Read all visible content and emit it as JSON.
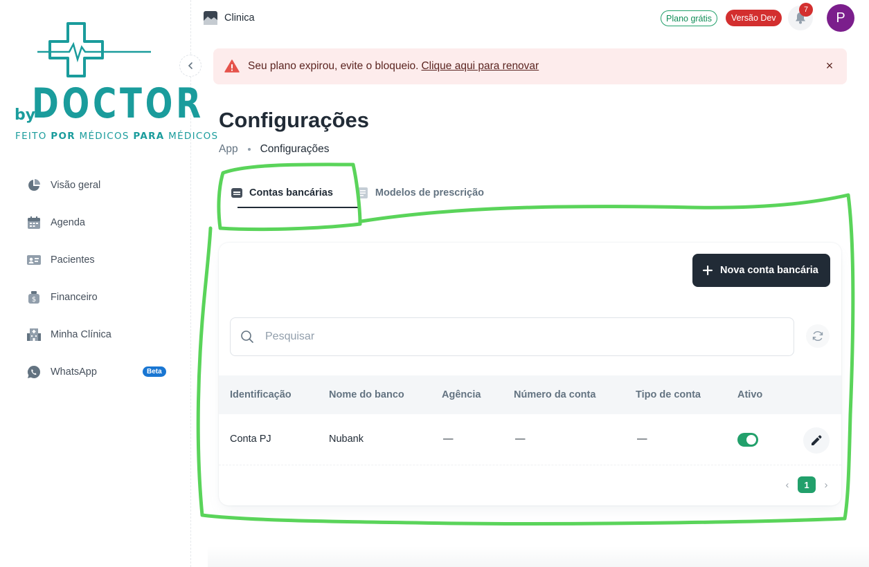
{
  "brand": {
    "by": "by",
    "name": "DOCTOR",
    "tagline_parts": [
      "FEITO ",
      "POR",
      " MÉDICOS ",
      "PARA",
      " MÉDICOS"
    ],
    "color": "#1a9c9c"
  },
  "sidebar": {
    "collapse_icon": "chevron-left-icon",
    "items": [
      {
        "label": "Visão geral",
        "icon": "pie-chart-icon"
      },
      {
        "label": "Agenda",
        "icon": "calendar-icon"
      },
      {
        "label": "Pacientes",
        "icon": "id-card-icon"
      },
      {
        "label": "Financeiro",
        "icon": "money-bag-icon"
      },
      {
        "label": "Minha Clínica",
        "icon": "building-icon"
      },
      {
        "label": "WhatsApp",
        "icon": "whatsapp-icon",
        "badge": "Beta"
      }
    ]
  },
  "topbar": {
    "clinic_name": "Clinica",
    "plan_badge": "Plano grátis",
    "version_badge": "Versão Dev",
    "notification_count": "7",
    "avatar_initial": "P"
  },
  "alert": {
    "message": "Seu plano expirou, evite o bloqueio.",
    "link": "Clique aqui para renovar",
    "close": "×"
  },
  "page": {
    "title": "Configurações",
    "breadcrumb": [
      "App",
      "Configurações"
    ]
  },
  "tabs": [
    {
      "label": "Contas bancárias",
      "icon": "bank-icon",
      "active": true
    },
    {
      "label": "Modelos de prescrição",
      "icon": "document-icon",
      "active": false
    }
  ],
  "toolbar": {
    "new_account_label": "Nova conta bancária",
    "search_placeholder": "Pesquisar"
  },
  "table": {
    "columns": [
      "Identificação",
      "Nome do banco",
      "Agência",
      "Número da conta",
      "Tipo de conta",
      "Ativo"
    ],
    "rows": [
      {
        "identificacao": "Conta PJ",
        "banco": "Nubank",
        "agencia": "—",
        "numero": "—",
        "tipo": "—",
        "ativo": true
      }
    ]
  },
  "pagination": {
    "current_page": "1",
    "prev": "‹",
    "next": "›"
  },
  "colors": {
    "accent_green": "#22a06b",
    "danger": "#d32f2f",
    "dark": "#212b36",
    "annotation": "#5ad45a"
  }
}
